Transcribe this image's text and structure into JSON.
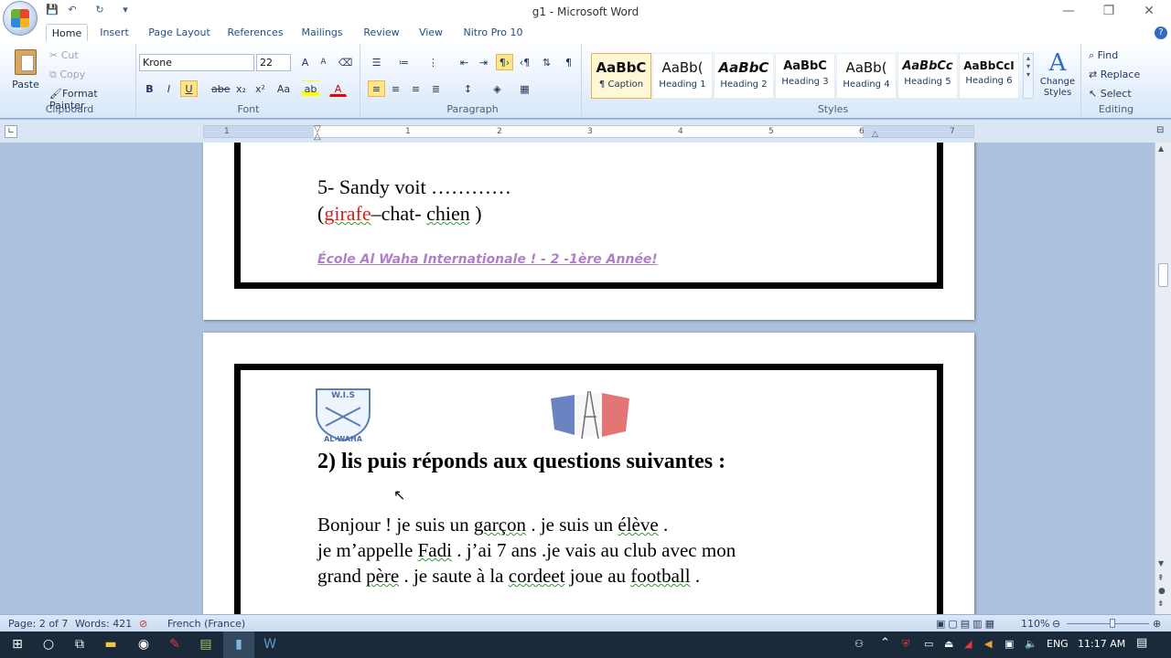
{
  "window": {
    "title": "g1 - Microsoft Word",
    "controls": {
      "minimize": "—",
      "maximize": "❐",
      "close": "✕"
    }
  },
  "quick_access": {
    "save": "💾",
    "undo": "↶",
    "redo": "↻"
  },
  "tabs": [
    "Home",
    "Insert",
    "Page Layout",
    "References",
    "Mailings",
    "Review",
    "View",
    "Nitro Pro 10"
  ],
  "ribbon": {
    "clipboard": {
      "label": "Clipboard",
      "paste": "Paste",
      "cut": "Cut",
      "copy": "Copy",
      "format_painter": "Format Painter"
    },
    "font": {
      "label": "Font",
      "family": "Krone",
      "size": "22",
      "bold": "B",
      "italic": "I",
      "underline": "U",
      "strike": "abe",
      "sub": "x₂",
      "sup": "x²",
      "case": "Aa",
      "grow": "A",
      "shrink": "A"
    },
    "paragraph": {
      "label": "Paragraph",
      "pilcrow": "¶"
    },
    "styles": {
      "label": "Styles",
      "items": [
        {
          "sample": "AaBbC",
          "name": "¶ Caption"
        },
        {
          "sample": "AaBb(",
          "name": "Heading 1"
        },
        {
          "sample": "AaBbC",
          "name": "Heading 2"
        },
        {
          "sample": "AaBbC",
          "name": "Heading 3"
        },
        {
          "sample": "AaBb(",
          "name": "Heading 4"
        },
        {
          "sample": "AaBbCc",
          "name": "Heading 5"
        },
        {
          "sample": "AaBbCcI",
          "name": "Heading 6"
        }
      ],
      "change_styles": "Change Styles"
    },
    "editing": {
      "label": "Editing",
      "find": "Find",
      "replace": "Replace",
      "select": "Select"
    }
  },
  "ruler": {
    "numbers": [
      "1",
      "1",
      "2",
      "3",
      "4",
      "5",
      "6",
      "7"
    ]
  },
  "document": {
    "page1": {
      "q5_line": "5- Sandy voit  …………",
      "q5_open": "(",
      "q5_opt1": "girafe",
      "q5_sep1": "–chat- ",
      "q5_opt2": "chien",
      "q5_close": " )",
      "footer": "École Al Waha Internationale ! - 2 -1ère Année!"
    },
    "page2": {
      "logo_text": "W.I.S",
      "logo_sub": "AL-WAHA",
      "heading": "2) lis puis réponds aux questions suivantes :",
      "p1_a": "Bonjour ! je suis un ",
      "p1_b": "garçon",
      "p1_c": " . je suis un ",
      "p1_d": "élève",
      "p1_e": " .",
      "p2_a": "je m’appelle ",
      "p2_b": "Fadi",
      "p2_c": " . j’ai  7 ans .je vais au club avec mon",
      "p3_a": "grand ",
      "p3_b": "père",
      "p3_c": "  . je saute  à la ",
      "p3_d": "cordeet",
      "p3_e": " joue au ",
      "p3_f": "football",
      "p3_g": " ."
    }
  },
  "status": {
    "page": "Page: 2 of 7",
    "words": "Words: 421",
    "language": "French (France)",
    "zoom": "110%",
    "zoom_fraction": 0.55
  },
  "taskbar": {
    "time": "11:17 AM",
    "lang": "ENG"
  },
  "colors": {
    "ribbon_border": "#8eaad4",
    "accent_red": "#d82020",
    "footer_purple": "#b07fc8"
  }
}
